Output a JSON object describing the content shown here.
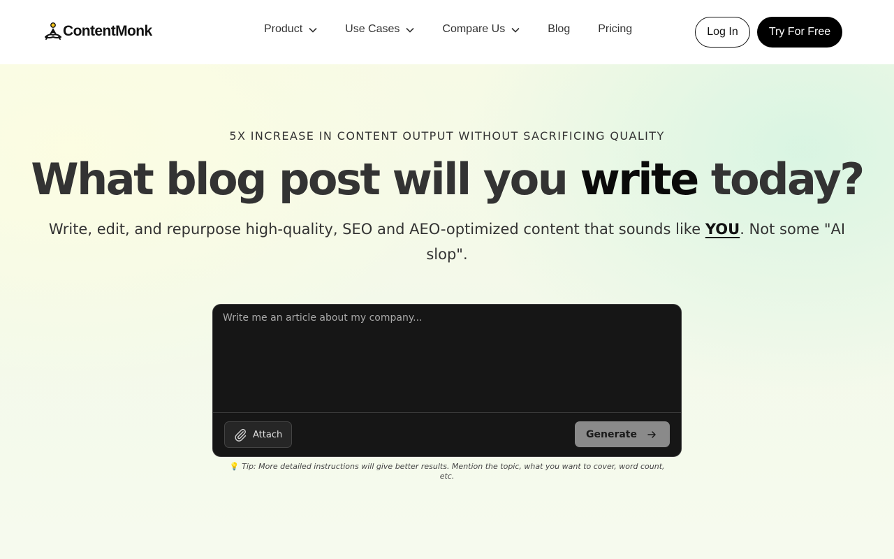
{
  "brand": {
    "name": "ContentMonk"
  },
  "nav": {
    "items": [
      {
        "label": "Product",
        "has_dropdown": true
      },
      {
        "label": "Use Cases",
        "has_dropdown": true
      },
      {
        "label": "Compare Us",
        "has_dropdown": true
      },
      {
        "label": "Blog",
        "has_dropdown": false
      },
      {
        "label": "Pricing",
        "has_dropdown": false
      }
    ],
    "login_label": "Log In",
    "cta_label": "Try For Free"
  },
  "hero": {
    "eyebrow": "5X INCREASE IN CONTENT OUTPUT WITHOUT SACRIFICING QUALITY",
    "headline_part1": "What blog post will you ",
    "headline_strong": "write",
    "headline_part2": " today?",
    "subhead_part1": "Write, edit, and repurpose high-quality, SEO and AEO-optimized content that sounds like ",
    "subhead_emphasis": "YOU",
    "subhead_part2": ". Not some \"AI slop\"."
  },
  "composer": {
    "value": "",
    "placeholder": "Write me an article about my company...",
    "attach_label": "Attach",
    "generate_label": "Generate"
  },
  "tip": {
    "icon": "lightbulb-icon",
    "text": "Tip: More detailed instructions will give better results. Mention the topic, what you want to cover, word count, etc."
  },
  "colors": {
    "primary_button": "#000000",
    "composer_bg": "#161616",
    "generate_bg": "#8a8a8a",
    "hero_bg_left": "#fcfde2",
    "hero_bg_right": "#d6f4e2"
  }
}
